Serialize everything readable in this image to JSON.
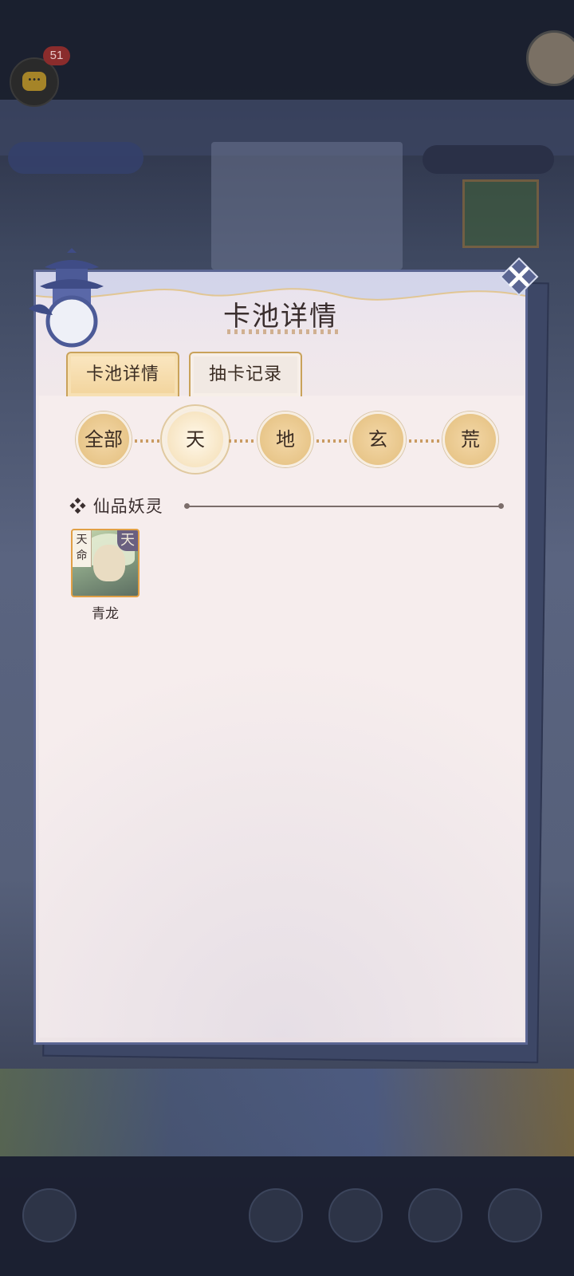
{
  "background": {
    "chat_badge_count": "51",
    "nav_labels": [
      "",
      "",
      "",
      ""
    ]
  },
  "dialog": {
    "title": "卡池详情",
    "close_icon": "close-x-icon",
    "tabs": [
      {
        "label": "卡池详情",
        "active": true
      },
      {
        "label": "抽卡记录",
        "active": false
      }
    ],
    "filters": [
      {
        "label": "全部",
        "active": false
      },
      {
        "label": "天",
        "active": true
      },
      {
        "label": "地",
        "active": false
      },
      {
        "label": "玄",
        "active": false
      },
      {
        "label": "荒",
        "active": false
      }
    ],
    "section": {
      "bullet": "❖",
      "title": "仙品妖灵"
    },
    "cards": [
      {
        "name": "青龙",
        "tag": "天命",
        "grade": "天"
      }
    ]
  },
  "colors": {
    "frame": "#5a6592",
    "tab_active": "#f2d49c",
    "filter_gold": "#e8c68a",
    "card_border": "#e1a046",
    "text": "#3a2e2e"
  }
}
